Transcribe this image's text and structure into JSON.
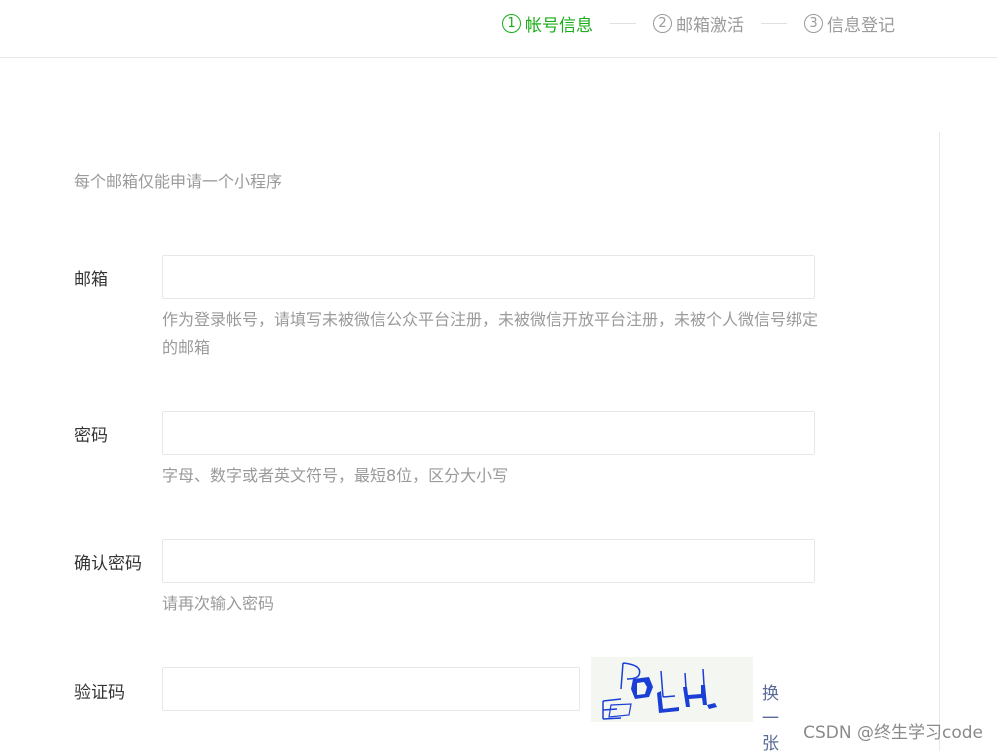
{
  "steps": [
    {
      "num": "1",
      "label": "帐号信息",
      "active": true
    },
    {
      "num": "2",
      "label": "邮箱激活",
      "active": false
    },
    {
      "num": "3",
      "label": "信息登记",
      "active": false
    }
  ],
  "intro": "每个邮箱仅能申请一个小程序",
  "form": {
    "email": {
      "label": "邮箱",
      "value": "",
      "hint": "作为登录帐号，请填写未被微信公众平台注册，未被微信开放平台注册，未被个人微信号绑定的邮箱"
    },
    "password": {
      "label": "密码",
      "value": "",
      "hint": "字母、数字或者英文符号，最短8位，区分大小写"
    },
    "confirm": {
      "label": "确认密码",
      "value": "",
      "hint": "请再次输入密码"
    },
    "captcha": {
      "label": "验证码",
      "value": "",
      "refresh_label": "换一张"
    }
  },
  "watermark": "CSDN @终生学习code",
  "colors": {
    "accent": "#1aad19",
    "link": "#576b95",
    "captcha_blue": "#1a3fd6"
  }
}
